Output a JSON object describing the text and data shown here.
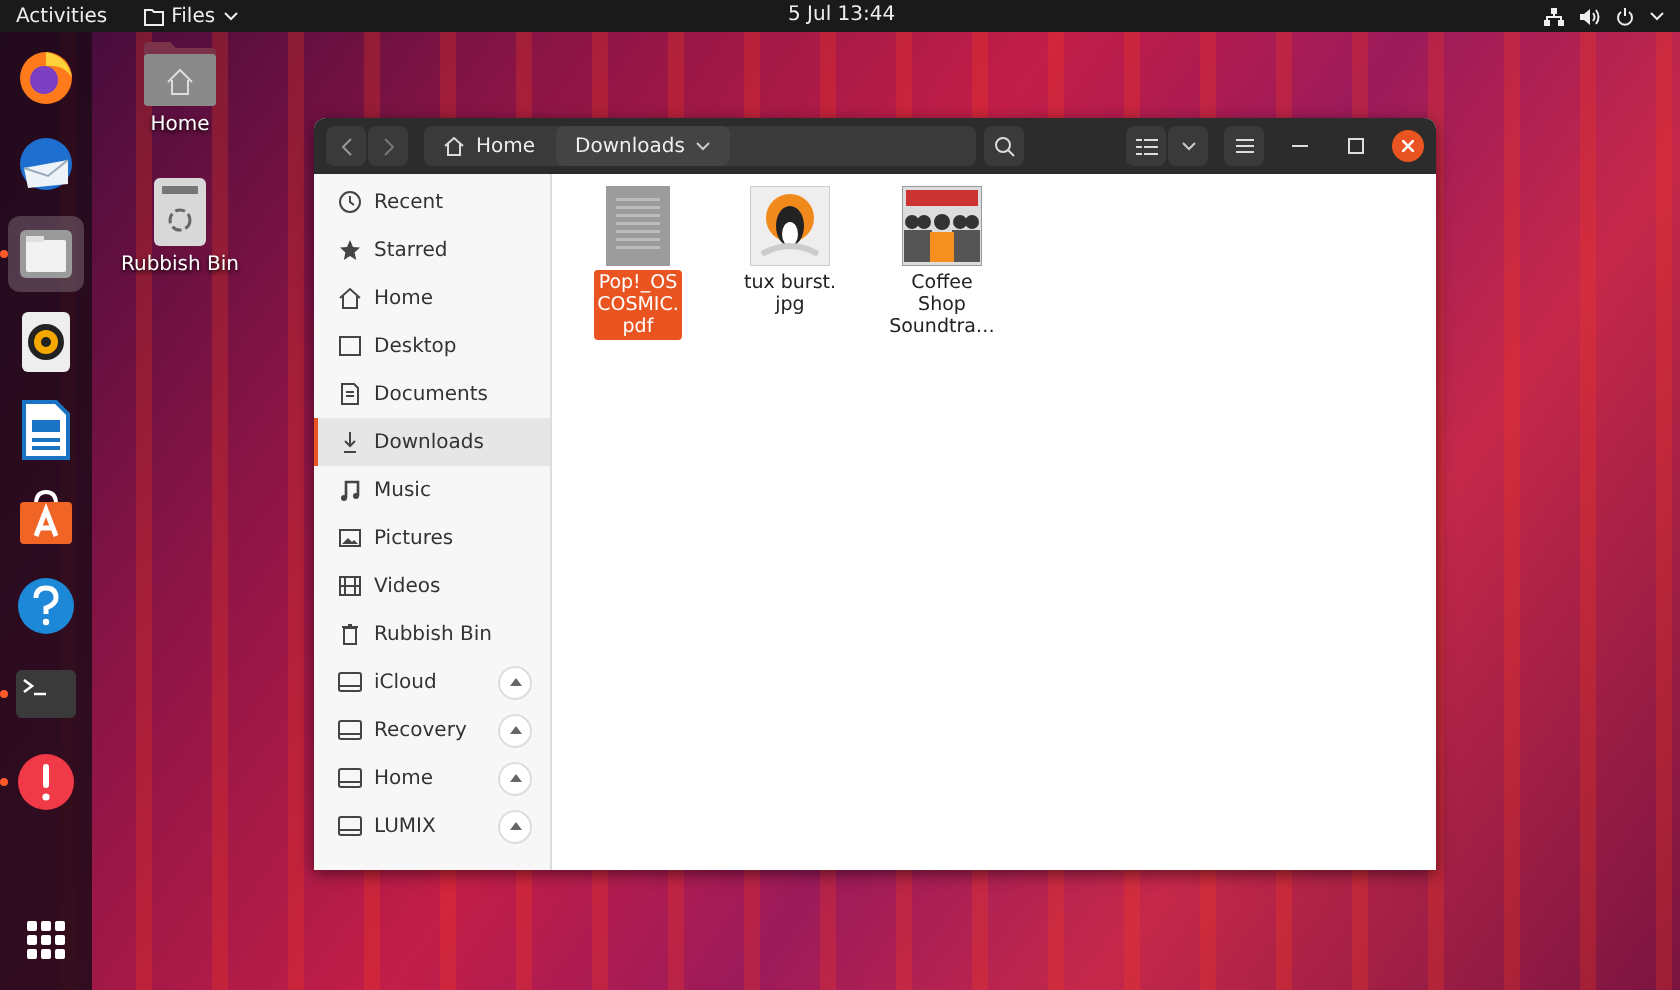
{
  "top_bar": {
    "activities": "Activities",
    "app_menu": "Files",
    "clock": "5 Jul  13:44"
  },
  "dock": {
    "items": [
      {
        "kind": "firefox",
        "running": false,
        "selected": false
      },
      {
        "kind": "mail",
        "running": false,
        "selected": false
      },
      {
        "kind": "files",
        "running": true,
        "selected": true
      },
      {
        "kind": "music",
        "running": false,
        "selected": false
      },
      {
        "kind": "writer",
        "running": false,
        "selected": false
      },
      {
        "kind": "software",
        "running": false,
        "selected": false
      },
      {
        "kind": "help",
        "running": false,
        "selected": false
      },
      {
        "kind": "terminal",
        "running": true,
        "selected": false
      },
      {
        "kind": "alert",
        "running": true,
        "selected": false
      },
      {
        "kind": "apps",
        "running": false,
        "selected": false
      }
    ]
  },
  "desktop_icons": [
    {
      "kind": "home",
      "label": "Home"
    },
    {
      "kind": "trash",
      "label": "Rubbish Bin"
    }
  ],
  "window": {
    "path": [
      {
        "kind": "home",
        "label": "Home"
      },
      {
        "kind": "current",
        "label": "Downloads"
      }
    ],
    "sidebar": {
      "places": [
        {
          "kind": "recent",
          "label": "Recent",
          "selected": false
        },
        {
          "kind": "star",
          "label": "Starred",
          "selected": false
        },
        {
          "kind": "home",
          "label": "Home",
          "selected": false
        },
        {
          "kind": "desktop",
          "label": "Desktop",
          "selected": false
        },
        {
          "kind": "documents",
          "label": "Documents",
          "selected": false
        },
        {
          "kind": "downloads",
          "label": "Downloads",
          "selected": true
        },
        {
          "kind": "music",
          "label": "Music",
          "selected": false
        },
        {
          "kind": "pictures",
          "label": "Pictures",
          "selected": false
        },
        {
          "kind": "videos",
          "label": "Videos",
          "selected": false
        },
        {
          "kind": "trash",
          "label": "Rubbish Bin",
          "selected": false
        }
      ],
      "devices": [
        {
          "label": "iCloud"
        },
        {
          "label": "Recovery"
        },
        {
          "label": "Home"
        },
        {
          "label": "LUMIX"
        }
      ]
    },
    "files": [
      {
        "kind": "document",
        "lines": [
          "Pop!_OS",
          "COSMIC.",
          "pdf"
        ],
        "selected": true
      },
      {
        "kind": "penguin",
        "lines": [
          "tux burst.",
          "jpg"
        ],
        "selected": false
      },
      {
        "kind": "album",
        "lines": [
          "Coffee",
          "Shop",
          "Soundtra…"
        ],
        "selected": false
      }
    ]
  }
}
